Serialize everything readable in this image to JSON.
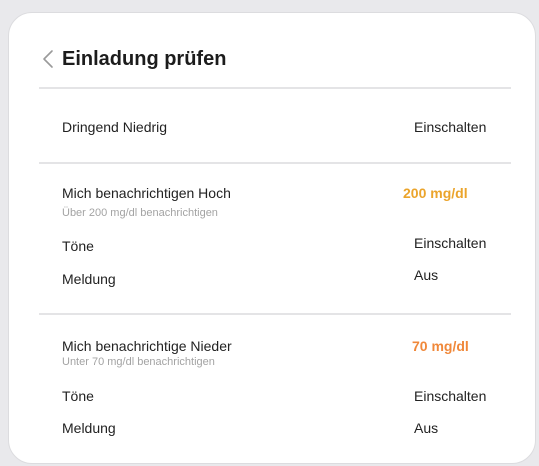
{
  "header": {
    "title": "Einladung prüfen",
    "back_icon": "chevron-left-icon"
  },
  "urgent_low": {
    "label": "Dringend Niedrig",
    "value": "Einschalten"
  },
  "high_alert": {
    "label": "Mich benachrichtigen Hoch",
    "description": "Über 200 mg/dl benachrichtigen",
    "threshold": "200 mg/dl",
    "threshold_color": "#eba42b",
    "tones_label": "Töne",
    "tones_value": "Einschalten",
    "notification_label": "Meldung",
    "notification_value": "Aus"
  },
  "low_alert": {
    "label": "Mich benachrichtige Nieder",
    "description": "Unter 70 mg/dl benachrichtigen",
    "threshold": "70 mg/dl",
    "threshold_color": "#f0883a",
    "tones_label": "Töne",
    "tones_value": "Einschalten",
    "notification_label": "Meldung",
    "notification_value": "Aus"
  }
}
